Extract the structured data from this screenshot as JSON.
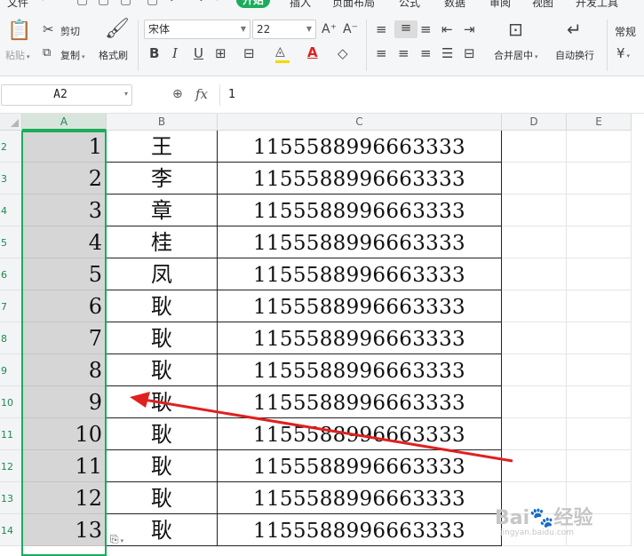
{
  "menu": {
    "items": [
      "文件",
      "开始",
      "插入",
      "页面布局",
      "公式",
      "数据",
      "审阅",
      "视图",
      "开发工具"
    ],
    "active": "开始"
  },
  "toolbar": {
    "paste_label": "粘贴",
    "cut_label": "剪切",
    "copy_label": "复制",
    "format_painter_label": "格式刷",
    "font_name": "宋体",
    "font_size": "22",
    "bold": "B",
    "italic": "I",
    "underline": "U",
    "font_color_glyph": "A",
    "grow_font_glyph": "A⁺",
    "shrink_font_glyph": "A⁻",
    "merge_center_label": "合并居中",
    "wrap_text_label": "自动换行",
    "number_format": "常规",
    "currency_glyph": "¥",
    "accent_color": "#1aad5a",
    "fill_color": "#f5d800",
    "font_color": "#e02020"
  },
  "formula_bar": {
    "name_box": "A2",
    "fx_label": "fx",
    "value": "1"
  },
  "grid": {
    "columns": [
      "A",
      "B",
      "C",
      "D",
      "E"
    ],
    "selected_column": "A",
    "rows": [
      {
        "num": "2",
        "a": "1",
        "b": "王",
        "c": "1155588996663333"
      },
      {
        "num": "3",
        "a": "2",
        "b": "李",
        "c": "1155588996663333"
      },
      {
        "num": "4",
        "a": "3",
        "b": "章",
        "c": "1155588996663333"
      },
      {
        "num": "5",
        "a": "4",
        "b": "桂",
        "c": "1155588996663333"
      },
      {
        "num": "6",
        "a": "5",
        "b": "凤",
        "c": "1155588996663333"
      },
      {
        "num": "7",
        "a": "6",
        "b": "耿",
        "c": "1155588996663333"
      },
      {
        "num": "8",
        "a": "7",
        "b": "耿",
        "c": "1155588996663333"
      },
      {
        "num": "9",
        "a": "8",
        "b": "耿",
        "c": "1155588996663333"
      },
      {
        "num": "10",
        "a": "9",
        "b": "耿",
        "c": "1155588996663333"
      },
      {
        "num": "11",
        "a": "10",
        "b": "耿",
        "c": "1155588996663333"
      },
      {
        "num": "12",
        "a": "11",
        "b": "耿",
        "c": "1155588996663333"
      },
      {
        "num": "13",
        "a": "12",
        "b": "耿",
        "c": "1155588996663333"
      },
      {
        "num": "14",
        "a": "13",
        "b": "耿",
        "c": "1155588996663333"
      }
    ],
    "annotation_arrow_color": "#e02020"
  }
}
